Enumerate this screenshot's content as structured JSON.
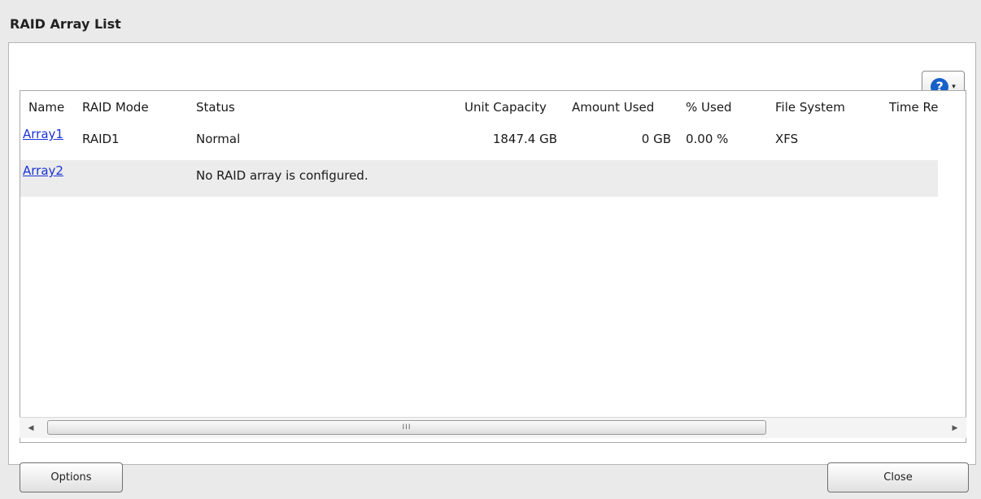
{
  "title": "RAID Array List",
  "help": {
    "icon": "help-icon",
    "glyph": "?",
    "caret": "▾"
  },
  "table": {
    "headers": [
      "Name",
      "RAID Mode",
      "Status",
      "Unit Capacity",
      "Amount Used",
      "% Used",
      "File System",
      "Time Re"
    ],
    "rows": [
      {
        "name": "Array1",
        "mode": "RAID1",
        "status": "Normal",
        "capacity": "1847.4 GB",
        "used": "0 GB",
        "pct": "0.00 %",
        "fs": "XFS",
        "time": ""
      },
      {
        "name": "Array2",
        "mode": "",
        "status": "No RAID array is configured.",
        "capacity": "",
        "used": "",
        "pct": "",
        "fs": "",
        "time": ""
      }
    ]
  },
  "scrollbar": {
    "left": "◀",
    "right": "▶",
    "grip": "III"
  },
  "buttons": {
    "options": "Options",
    "close": "Close"
  }
}
